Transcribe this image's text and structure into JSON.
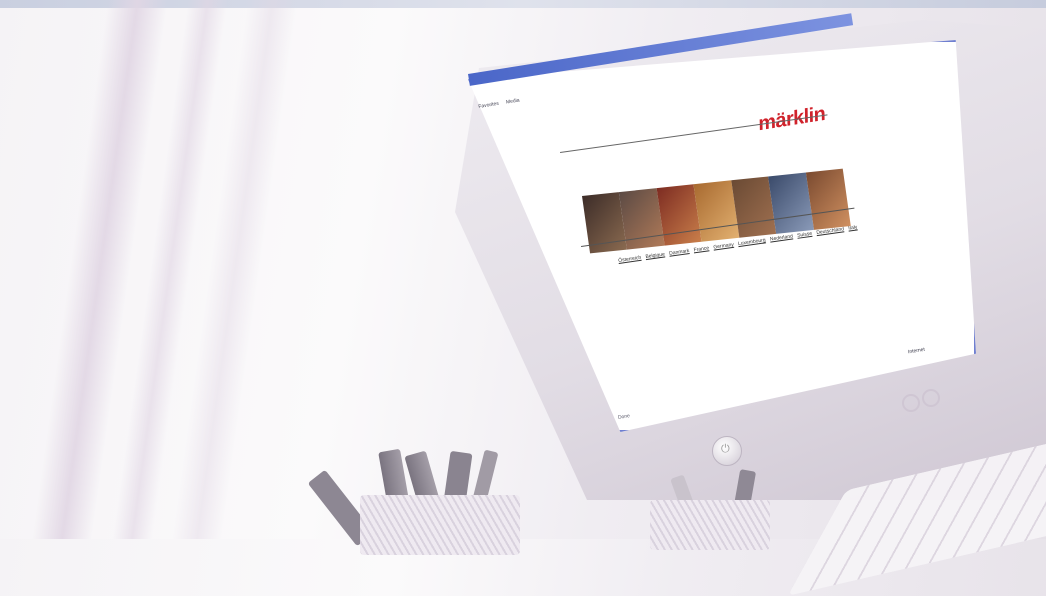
{
  "browser": {
    "window_title": "",
    "toolbar_items": [
      "Favorites",
      "Media"
    ]
  },
  "site": {
    "logo_text": "märklin",
    "country_links": [
      "Österreich",
      "Belgique",
      "Danmark",
      "France",
      "Germany",
      "Luxembourg",
      "Nederland",
      "Suisse",
      "Deutschland",
      "Italy"
    ]
  },
  "status_bar": {
    "left": "Done",
    "right": "Internet"
  },
  "colors": {
    "logo_red": "#d0222b",
    "titlebar_blue": "#4a66c8"
  }
}
